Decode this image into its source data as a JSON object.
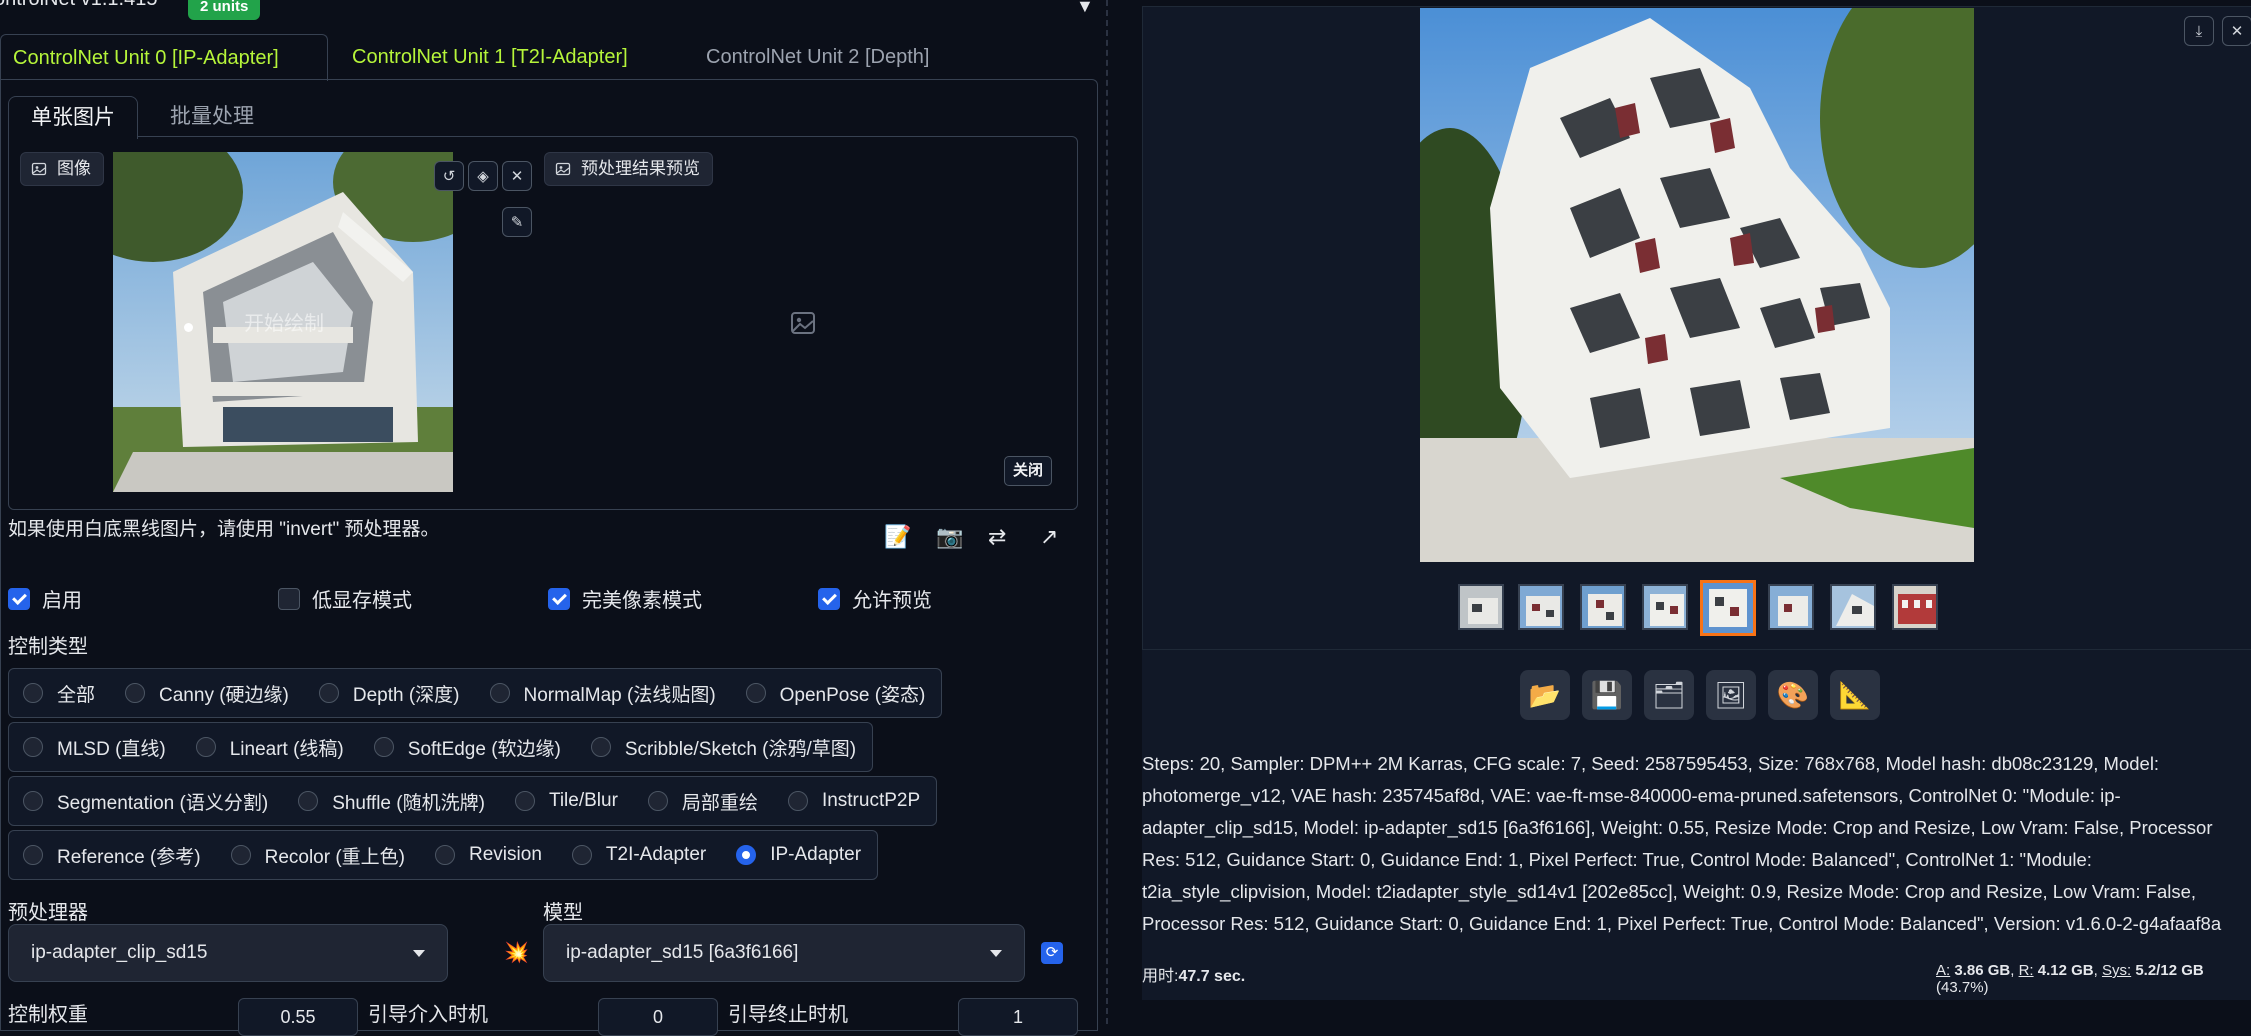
{
  "header": {
    "title": "ontrolNet v1.1.415",
    "badge": "2 units"
  },
  "unit_tabs": [
    "ControlNet Unit 0 [IP-Adapter]",
    "ControlNet Unit 1 [T2I-Adapter]",
    "ControlNet Unit 2 [Depth]"
  ],
  "image_tabs": [
    "单张图片",
    "批量处理"
  ],
  "image_panel": {
    "image_label": "图像",
    "preview_label": "预处理结果预览",
    "draw_label": "开始绘制",
    "close_label": "关闭"
  },
  "hint": "如果使用白底黑线图片，请使用 \"invert\" 预处理器。",
  "tools": [
    "📝",
    "📷",
    "⇄",
    "↗"
  ],
  "checkboxes": [
    {
      "label": "启用",
      "checked": true
    },
    {
      "label": "低显存模式",
      "checked": false
    },
    {
      "label": "完美像素模式",
      "checked": true
    },
    {
      "label": "允许预览",
      "checked": true
    }
  ],
  "control_type_label": "控制类型",
  "control_types": [
    [
      "全部",
      "Canny (硬边缘)",
      "Depth (深度)",
      "NormalMap (法线贴图)",
      "OpenPose (姿态)"
    ],
    [
      "MLSD (直线)",
      "Lineart (线稿)",
      "SoftEdge (软边缘)",
      "Scribble/Sketch (涂鸦/草图)"
    ],
    [
      "Segmentation (语义分割)",
      "Shuffle (随机洗牌)",
      "Tile/Blur",
      "局部重绘",
      "InstructP2P"
    ],
    [
      "Reference (参考)",
      "Recolor (重上色)",
      "Revision",
      "T2I-Adapter",
      "IP-Adapter"
    ]
  ],
  "selected_control_type": "IP-Adapter",
  "preprocessor": {
    "label": "预处理器",
    "value": "ip-adapter_clip_sd15"
  },
  "model": {
    "label": "模型",
    "value": "ip-adapter_sd15 [6a3f6166]"
  },
  "weights": {
    "weight_label": "控制权重",
    "weight_value": "0.55",
    "start_label": "引导介入时机",
    "start_value": "0",
    "end_label": "引导终止时机",
    "end_value": "1"
  },
  "output": {
    "thumb_count": 8,
    "selected_thumb": 4,
    "toolbar_icons": [
      "📂",
      "💾",
      "🗂",
      "🖼",
      "🎨",
      "📐"
    ],
    "info": "Steps: 20, Sampler: DPM++ 2M Karras, CFG scale: 7, Seed: 2587595453, Size: 768x768, Model hash: db08c23129, Model: photomerge_v12, VAE hash: 235745af8d, VAE: vae-ft-mse-840000-ema-pruned.safetensors, ControlNet 0: \"Module: ip-adapter_clip_sd15, Model: ip-adapter_sd15 [6a3f6166], Weight: 0.55, Resize Mode: Crop and Resize, Low Vram: False, Processor Res: 512, Guidance Start: 0, Guidance End: 1, Pixel Perfect: True, Control Mode: Balanced\", ControlNet 1: \"Module: t2ia_style_clipvision, Model: t2iadapter_style_sd14v1 [202e85cc], Weight: 0.9, Resize Mode: Crop and Resize, Low Vram: False, Processor Res: 512, Guidance Start: 0, Guidance End: 1, Pixel Perfect: True, Control Mode: Balanced\", Version: v1.6.0-2-g4afaaf8a",
    "time_prefix": "用时:",
    "time_value": "47.7 sec.",
    "mem": {
      "a_label": "A:",
      "a": "3.86 GB",
      "r_label": "R:",
      "r": "4.12 GB",
      "sys_label": "Sys:",
      "sys": "5.2/12 GB",
      "pct": "(43.7%)"
    }
  },
  "colors": {
    "background": "#0b0f19",
    "accent_green": "#b6f53a",
    "selected_blue": "#2563eb",
    "badge_green": "#22a34a",
    "thumb_selected": "#f97316"
  }
}
